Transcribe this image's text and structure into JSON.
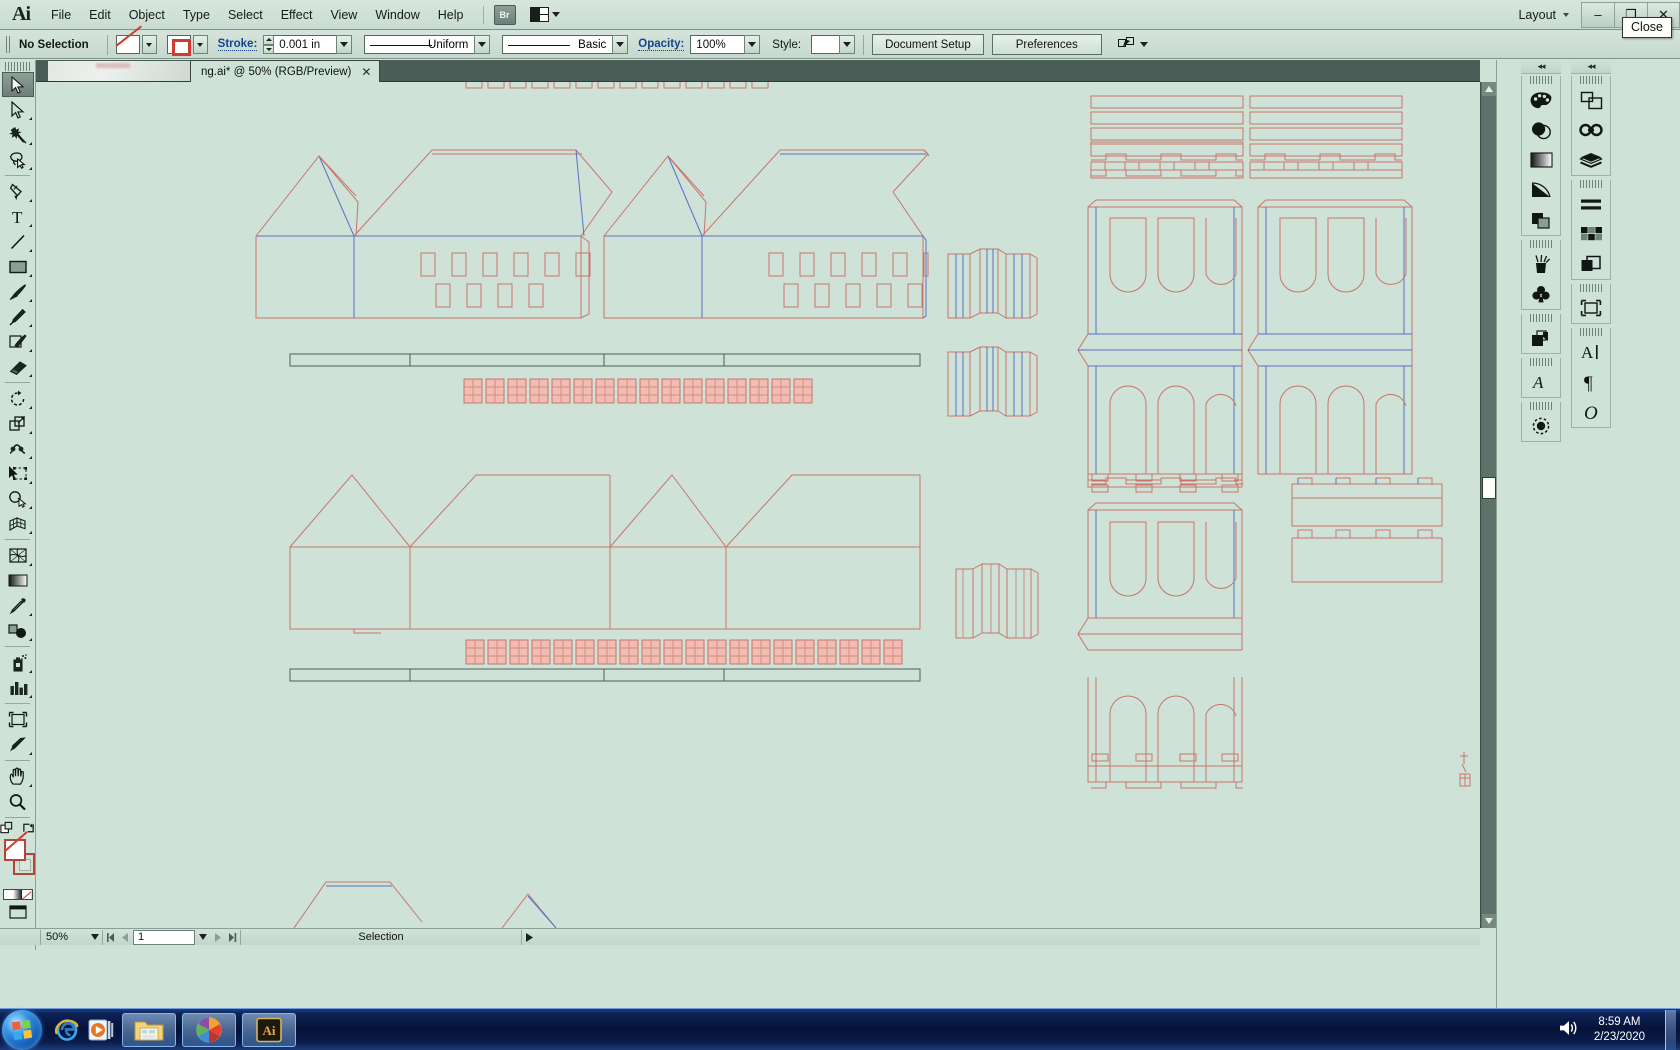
{
  "app": {
    "name": "Adobe Illustrator",
    "logo": "Ai"
  },
  "menubar": {
    "items": [
      {
        "label": "File"
      },
      {
        "label": "Edit"
      },
      {
        "label": "Object"
      },
      {
        "label": "Type"
      },
      {
        "label": "Select"
      },
      {
        "label": "Effect"
      },
      {
        "label": "View"
      },
      {
        "label": "Window"
      },
      {
        "label": "Help"
      }
    ],
    "bridge_label": "Br",
    "arrange_documents_name": "arrange-documents-icon",
    "workspace_label": "Layout"
  },
  "window_controls": {
    "minimize": "–",
    "restore": "❐",
    "close": "✕",
    "tooltip": "Close"
  },
  "control_bar": {
    "selection_status": "No Selection",
    "fill_swatch_name": "fill-none-swatch",
    "stroke_swatch_name": "stroke-red-swatch",
    "stroke_label": "Stroke:",
    "stroke_weight": "0.001 in",
    "stroke_profile": "Uniform",
    "brush_definition": "Basic",
    "opacity_label": "Opacity:",
    "opacity_value": "100%",
    "style_label": "Style:",
    "style_value": "",
    "document_setup_label": "Document Setup",
    "preferences_label": "Preferences",
    "select_similar_name": "select-similar-objects-icon"
  },
  "document_tab": {
    "title": "ng.ai* @ 50% (RGB/Preview)",
    "close_glyph": "✕"
  },
  "toolbar": {
    "tools": [
      {
        "name": "selection-tool",
        "selected": true
      },
      {
        "name": "direct-selection-tool",
        "selected": false
      },
      {
        "name": "magic-wand-tool",
        "selected": false
      },
      {
        "name": "lasso-tool",
        "selected": false
      },
      {
        "name": "pen-tool",
        "selected": false
      },
      {
        "name": "type-tool",
        "selected": false
      },
      {
        "name": "line-segment-tool",
        "selected": false
      },
      {
        "name": "rectangle-tool",
        "selected": false
      },
      {
        "name": "paintbrush-tool",
        "selected": false
      },
      {
        "name": "pencil-tool",
        "selected": false
      },
      {
        "name": "blob-brush-tool",
        "selected": false
      },
      {
        "name": "eraser-tool",
        "selected": false
      },
      {
        "name": "rotate-tool",
        "selected": false
      },
      {
        "name": "scale-tool",
        "selected": false
      },
      {
        "name": "width-tool",
        "selected": false
      },
      {
        "name": "free-transform-tool",
        "selected": false
      },
      {
        "name": "shape-builder-tool",
        "selected": false
      },
      {
        "name": "perspective-grid-tool",
        "selected": false
      },
      {
        "name": "mesh-tool",
        "selected": false
      },
      {
        "name": "gradient-tool",
        "selected": false
      },
      {
        "name": "eyedropper-tool",
        "selected": false
      },
      {
        "name": "blend-tool",
        "selected": false
      },
      {
        "name": "symbol-sprayer-tool",
        "selected": false
      },
      {
        "name": "column-graph-tool",
        "selected": false
      },
      {
        "name": "artboard-tool",
        "selected": false
      },
      {
        "name": "slice-tool",
        "selected": false
      },
      {
        "name": "hand-tool",
        "selected": false
      },
      {
        "name": "zoom-tool",
        "selected": false
      }
    ],
    "fill_stroke_name": "fill-and-stroke-swatches",
    "default_colors_name": "default-fill-stroke-icon",
    "swap_colors_name": "swap-fill-stroke-icon",
    "color_mode_name": "color-gradient-none-swatches",
    "screen_mode_name": "change-screen-mode-icon"
  },
  "status_bar": {
    "zoom_level": "50%",
    "first_page_name": "first-artboard-icon",
    "prev_page_name": "previous-artboard-icon",
    "page_number": "1",
    "next_page_name": "next-artboard-icon",
    "last_page_name": "last-artboard-icon",
    "status_text": "Selection"
  },
  "panel_dock": {
    "column_left": [
      {
        "name": "color-panel-icon",
        "label": "Color"
      },
      {
        "name": "color-guide-panel-icon",
        "label": "Color Guide"
      },
      {
        "name": "gradient-panel-icon",
        "label": "Gradient"
      },
      {
        "name": "transparency-panel-icon",
        "label": "Transparency"
      },
      {
        "name": "appearance-panel-icon",
        "label": "Appearance"
      },
      {
        "name": "brushes-panel-icon",
        "label": "Brushes"
      },
      {
        "name": "symbols-panel-icon",
        "label": "Symbols"
      },
      {
        "name": "graphic-styles-panel-icon",
        "label": "Graphic Styles"
      },
      {
        "name": "type-panel-icon",
        "label": "Type"
      },
      {
        "name": "stroke-panel-icon",
        "label": "Stroke"
      }
    ],
    "column_right": [
      {
        "name": "transform-panel-icon",
        "label": "Transform"
      },
      {
        "name": "links-panel-icon",
        "label": "Links"
      },
      {
        "name": "layers-panel-icon",
        "label": "Layers"
      },
      {
        "name": "align-panel-icon",
        "label": "Align"
      },
      {
        "name": "swatches-panel-icon",
        "label": "Swatches"
      },
      {
        "name": "pathfinder-panel-icon",
        "label": "Pathfinder"
      },
      {
        "name": "artboards-panel-icon",
        "label": "Artboards"
      },
      {
        "name": "character-panel-icon",
        "label": "Character"
      },
      {
        "name": "paragraph-panel-icon",
        "label": "Paragraph"
      },
      {
        "name": "glyphs-panel-icon",
        "label": "Glyphs"
      }
    ],
    "collapse_glyph": "◂◂"
  },
  "taskbar": {
    "start_name": "start-orb",
    "quick_launch": [
      {
        "name": "internet-explorer-icon"
      },
      {
        "name": "windows-media-player-icon"
      }
    ],
    "running": [
      {
        "name": "windows-explorer-taskbar-button"
      },
      {
        "name": "picasa-taskbar-button"
      },
      {
        "name": "illustrator-taskbar-button",
        "label": "Ai"
      }
    ],
    "volume_name": "volume-icon",
    "clock_time": "8:59 AM",
    "clock_date": "2/23/2020",
    "show_desktop_name": "show-desktop-button"
  },
  "artwork": {
    "description": "Architectural papercraft model elevation line drawings",
    "stroke_red": "#c8746a",
    "stroke_blue": "#5b6fc4",
    "stroke_dark": "#4a6258",
    "fill_pink": "#e9a79c",
    "canvas_bg": "#cfe2d8"
  }
}
